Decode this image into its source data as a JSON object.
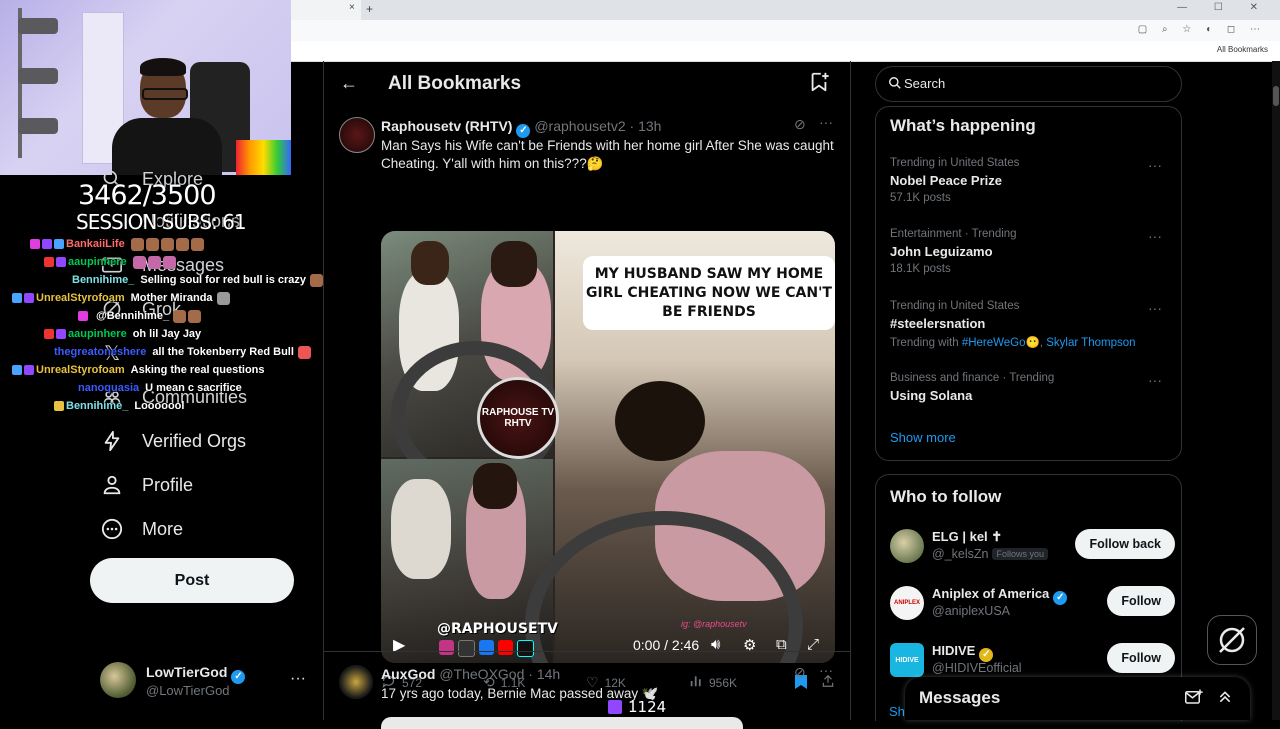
{
  "browser": {
    "tab_close": "×",
    "new_tab": "+",
    "all_bookmarks": "All Bookmarks"
  },
  "overlay": {
    "counter": "3462/3500",
    "session_subs": "SESSION SUBS: 61",
    "viewer_count": "1124",
    "chat": [
      {
        "user": "BankaiiLife",
        "user_color": "#ff6b6b",
        "message": "",
        "emotes": 5
      },
      {
        "user": "aaupinhere",
        "user_color": "#00c853",
        "message": "",
        "emotes": 3
      },
      {
        "user": "Bennihime_",
        "user_color": "#7fe0e8",
        "message": "Selling soul for red bull is crazy",
        "emotes": 1
      },
      {
        "user": "UnrealStyrofoam",
        "user_color": "#e8c23f",
        "message": "Mother Miranda",
        "emotes": 1
      },
      {
        "user": "",
        "user_color": "#ffffff",
        "message": "@Bennihime_",
        "emotes": 2
      },
      {
        "user": "aaupinhere",
        "user_color": "#00c853",
        "message": "oh lil Jay Jay",
        "emotes": 0
      },
      {
        "user": "thegreatoneshere",
        "user_color": "#3b5bff",
        "message": "all the Tokenberry Red Bull",
        "emotes": 1
      },
      {
        "user": "UnrealStyrofoam",
        "user_color": "#e8c23f",
        "message": "Asking the real questions",
        "emotes": 0
      },
      {
        "user": "nanoquasia",
        "user_color": "#3b5bff",
        "message": "U mean c sacrifice",
        "emotes": 0
      },
      {
        "user": "Bennihime_",
        "user_color": "#7fe0e8",
        "message": "Looooool",
        "emotes": 0
      }
    ]
  },
  "nav": {
    "explore": "Explore",
    "notifications": "Notifications",
    "messages": "Messages",
    "grok": "Grok",
    "lists": "Lists",
    "communities": "Communities",
    "verified_orgs": "Verified Orgs",
    "profile": "Profile",
    "more": "More",
    "post": "Post"
  },
  "account": {
    "name": "LowTierGod",
    "handle": "@LowTierGod",
    "more": "···"
  },
  "center": {
    "back": "←",
    "title": "All Bookmarks",
    "tweets": [
      {
        "name": "Raphousetv (RHTV)",
        "handle": "@raphousetv2",
        "time": "· 13h",
        "text": "Man Says his Wife can't be Friends with her home girl After She was caught Cheating. Y'all with him on this???🤔",
        "media": {
          "caption": "MY HUSBAND SAW MY HOME GIRL CHEATING NOW WE CAN'T BE FRIENDS",
          "logo": "RAPHOUSE TV RHTV",
          "watermark": "@RAPHOUSETV",
          "signature": "ig: @raphousetv",
          "time": "0:00 / 2:46"
        },
        "replies": "572",
        "reposts": "1.1K",
        "likes": "12K",
        "views": "956K"
      },
      {
        "name": "AuxGod",
        "handle": "@TheOXGod",
        "time": "· 14h",
        "text": "17 yrs ago today, Bernie Mac passed away 🕊️"
      }
    ]
  },
  "right": {
    "search_placeholder": "Search",
    "whats_happening": "What’s happening",
    "trends": [
      {
        "meta": "Trending in United States",
        "name": "Nobel Peace Prize",
        "sub": "57.1K posts"
      },
      {
        "meta": "Entertainment · Trending",
        "name": "John Leguizamo",
        "sub": "18.1K posts"
      },
      {
        "meta": "Trending in United States",
        "name": "#steelersnation",
        "sub_prefix": "Trending with",
        "sub_link1": "#HereWeGo😶",
        "sub_link2": "Skylar Thompson"
      },
      {
        "meta": "Business and finance · Trending",
        "name": "Using Solana",
        "sub": ""
      }
    ],
    "show_more": "Show more",
    "who_to_follow": "Who to follow",
    "follows": [
      {
        "name": "ELG | kel ✝",
        "handle": "@_kelsZn",
        "badge": "Follows you",
        "button": "Follow back",
        "verified": ""
      },
      {
        "name": "Aniplex of America",
        "handle": "@aniplexUSA",
        "badge": "",
        "button": "Follow",
        "verified": "blue"
      },
      {
        "name": "HIDIVE",
        "handle": "@HIDIVEofficial",
        "badge": "",
        "button": "Follow",
        "verified": "gold"
      }
    ],
    "show_partial": "Sh",
    "messages_title": "Messages"
  },
  "colors": {
    "accent": "#1d9bf0",
    "background": "#000000",
    "text": "#e7e9ea",
    "muted": "#71767b",
    "border": "#2f3336"
  }
}
